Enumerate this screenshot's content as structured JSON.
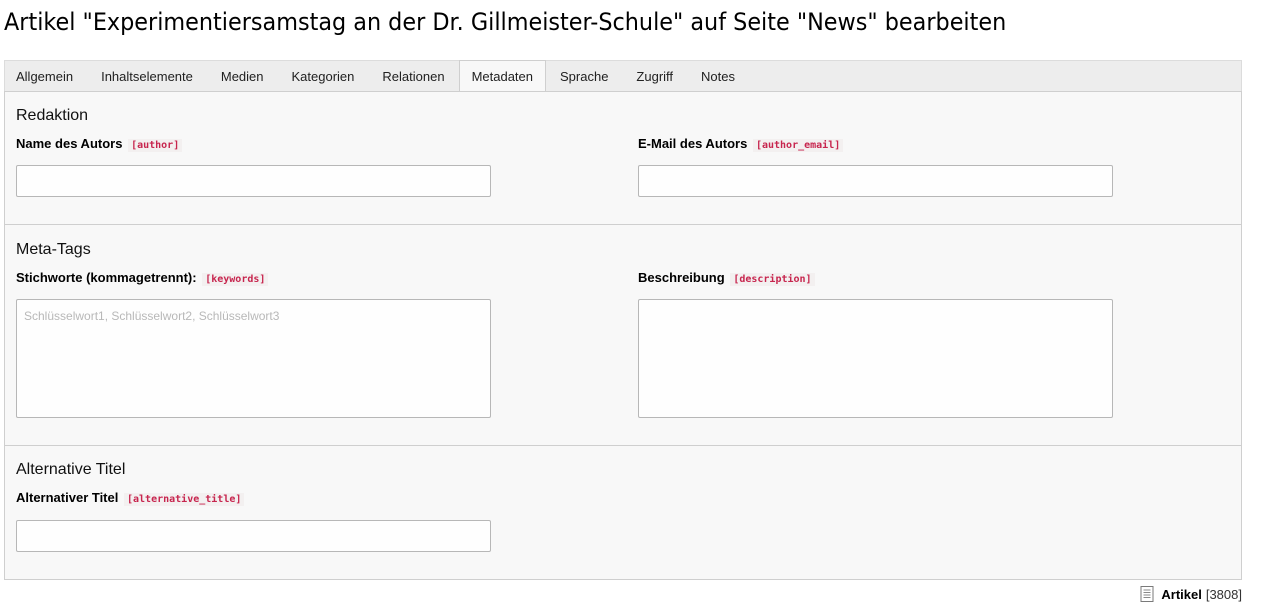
{
  "page": {
    "title": "Artikel \"Experimentiersamstag an der Dr. Gillmeister-Schule\" auf Seite \"News\" bearbeiten"
  },
  "tabs": [
    {
      "label": "Allgemein",
      "active": false
    },
    {
      "label": "Inhaltselemente",
      "active": false
    },
    {
      "label": "Medien",
      "active": false
    },
    {
      "label": "Kategorien",
      "active": false
    },
    {
      "label": "Relationen",
      "active": false
    },
    {
      "label": "Metadaten",
      "active": true
    },
    {
      "label": "Sprache",
      "active": false
    },
    {
      "label": "Zugriff",
      "active": false
    },
    {
      "label": "Notes",
      "active": false
    }
  ],
  "sections": {
    "redaktion": {
      "title": "Redaktion",
      "author": {
        "label": "Name des Autors",
        "key": "[author]",
        "value": ""
      },
      "author_email": {
        "label": "E-Mail des Autors",
        "key": "[author_email]",
        "value": ""
      }
    },
    "meta_tags": {
      "title": "Meta-Tags",
      "keywords": {
        "label": "Stichworte (kommagetrennt):",
        "key": "[keywords]",
        "placeholder": "Schlüsselwort1, Schlüsselwort2, Schlüsselwort3",
        "value": ""
      },
      "description": {
        "label": "Beschreibung",
        "key": "[description]",
        "value": ""
      }
    },
    "alternative": {
      "title": "Alternative Titel",
      "alternative_title": {
        "label": "Alternativer Titel",
        "key": "[alternative_title]",
        "value": ""
      }
    }
  },
  "footer": {
    "record_type": "Artikel",
    "record_uid": "[3808]",
    "icon": "document-icon"
  },
  "colors": {
    "field_key": "#c7254e",
    "panel_bg": "#f8f8f8",
    "tabbar_bg": "#ededed"
  }
}
